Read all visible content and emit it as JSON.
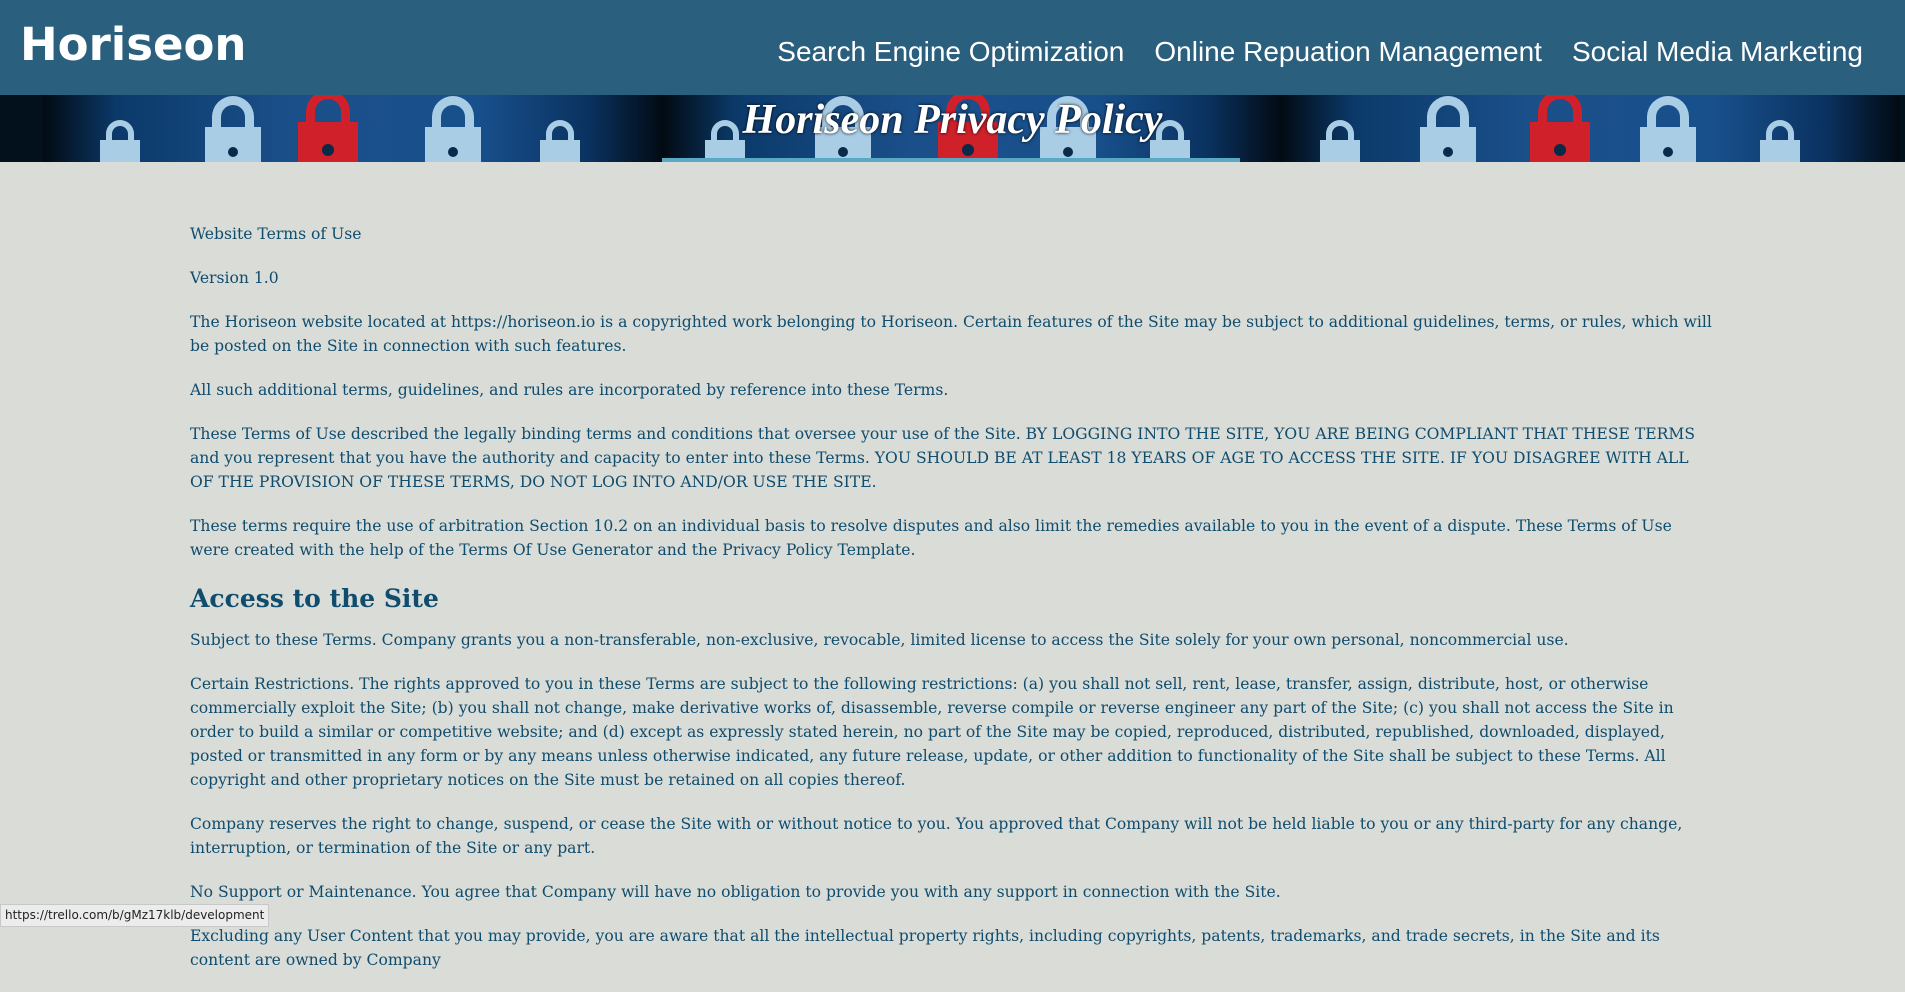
{
  "header": {
    "logo": "Horiseon",
    "nav": [
      "Search Engine Optimization",
      "Online Repuation Management",
      "Social Media Marketing"
    ]
  },
  "banner": {
    "title": "Horiseon Privacy Policy"
  },
  "content": {
    "p1": "Website Terms of Use",
    "p2": "Version 1.0",
    "p3": "The Horiseon website located at https://horiseon.io is a copyrighted work belonging to Horiseon. Certain features of the Site may be subject to additional guidelines, terms, or rules, which will be posted on the Site in connection with such features.",
    "p4": "All such additional terms, guidelines, and rules are incorporated by reference into these Terms.",
    "p5": "These Terms of Use described the legally binding terms and conditions that oversee your use of the Site. BY LOGGING INTO THE SITE, YOU ARE BEING COMPLIANT THAT THESE TERMS and you represent that you have the authority and capacity to enter into these Terms. YOU SHOULD BE AT LEAST 18 YEARS OF AGE TO ACCESS THE SITE. IF YOU DISAGREE WITH ALL OF THE PROVISION OF THESE TERMS, DO NOT LOG INTO AND/OR USE THE SITE.",
    "p6": "These terms require the use of arbitration Section 10.2 on an individual basis to resolve disputes and also limit the remedies available to you in the event of a dispute. These Terms of Use were created with the help of the Terms Of Use Generator and the Privacy Policy Template.",
    "heading": "Access to the Site",
    "p7": "Subject to these Terms. Company grants you a non-transferable, non-exclusive, revocable, limited license to access the Site solely for your own personal, noncommercial use.",
    "p8": "Certain Restrictions. The rights approved to you in these Terms are subject to the following restrictions: (a) you shall not sell, rent, lease, transfer, assign, distribute, host, or otherwise commercially exploit the Site; (b) you shall not change, make derivative works of, disassemble, reverse compile or reverse engineer any part of the Site; (c) you shall not access the Site in order to build a similar or competitive website; and (d) except as expressly stated herein, no part of the Site may be copied, reproduced, distributed, republished, downloaded, displayed, posted or transmitted in any form or by any means unless otherwise indicated, any future release, update, or other addition to functionality of the Site shall be subject to these Terms. All copyright and other proprietary notices on the Site must be retained on all copies thereof.",
    "p9": "Company reserves the right to change, suspend, or cease the Site with or without notice to you. You approved that Company will not be held liable to you or any third-party for any change, interruption, or termination of the Site or any part.",
    "p10": "No Support or Maintenance. You agree that Company will have no obligation to provide you with any support in connection with the Site.",
    "p11": "Excluding any User Content that you may provide, you are aware that all the intellectual property rights, including copyrights, patents, trademarks, and trade secrets, in the Site and its content are owned by Company"
  },
  "statusbar": {
    "url": "https://trello.com/b/gMz17klb/development"
  },
  "colors": {
    "header_bg": "#2a5f7e",
    "page_bg": "#d9dcd7",
    "text": "#0f4c6e"
  }
}
